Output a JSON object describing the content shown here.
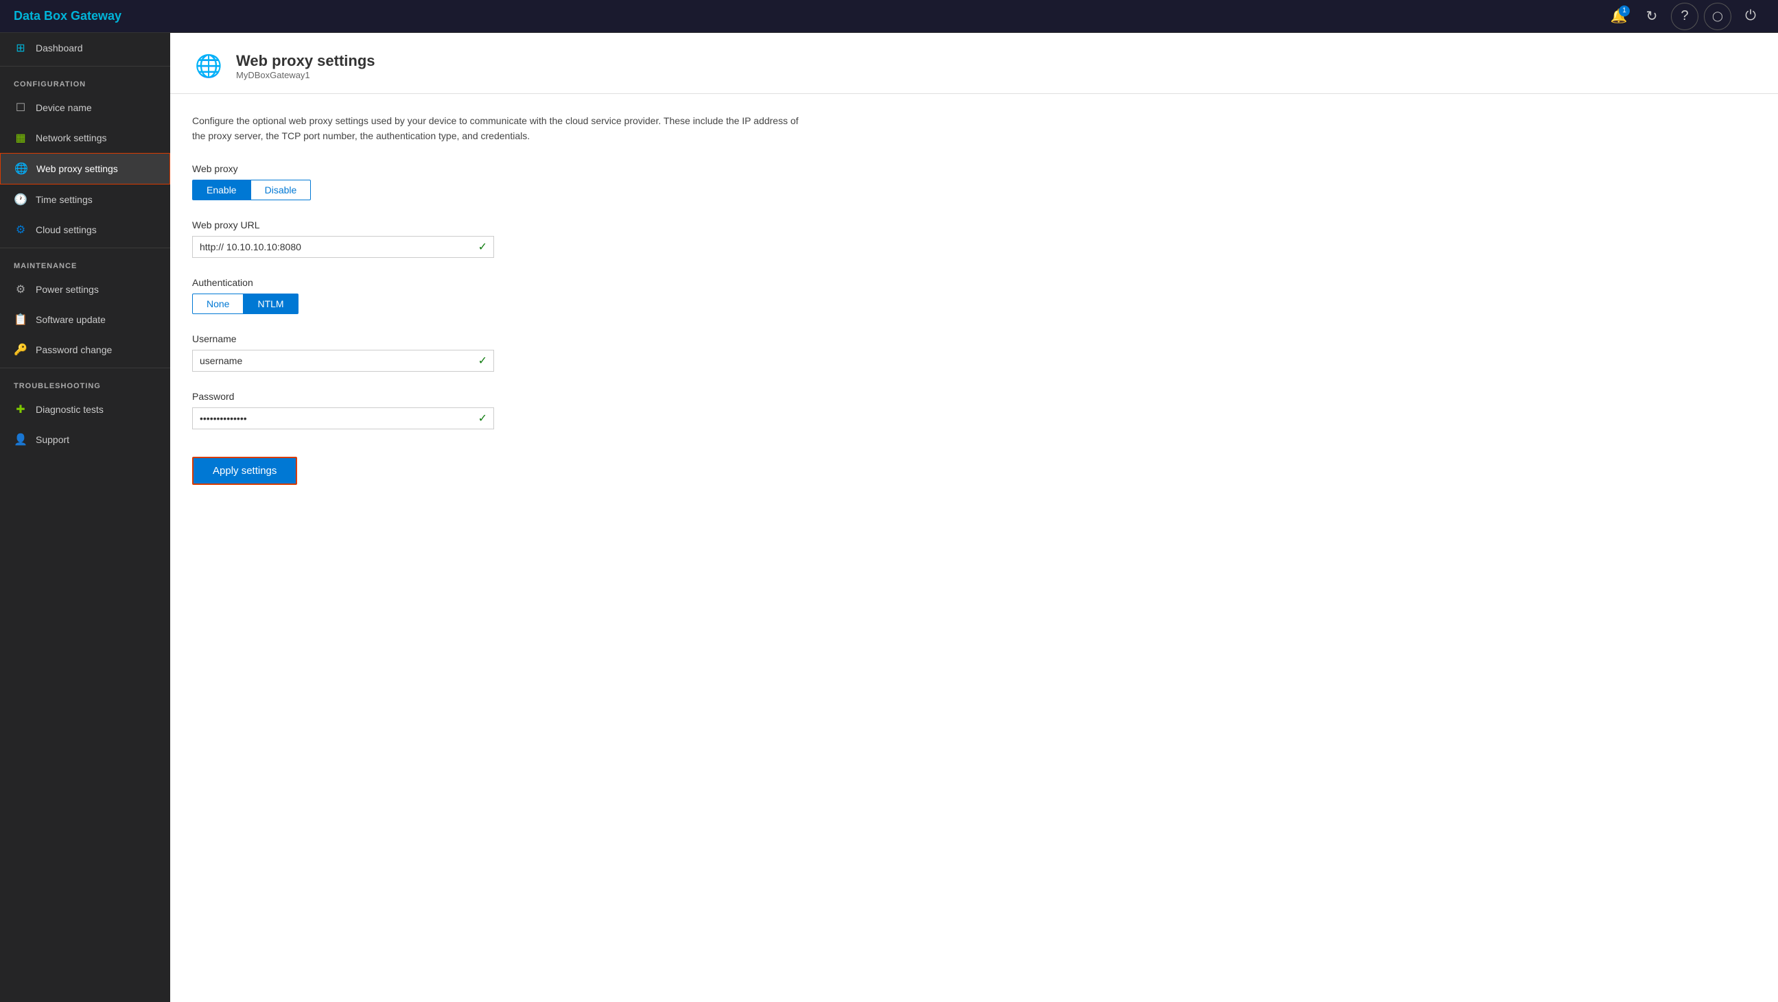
{
  "app": {
    "title": "Data Box Gateway"
  },
  "topbar": {
    "title": "Data Box Gateway",
    "icons": [
      {
        "name": "notification-icon",
        "symbol": "🔔",
        "badge": "1"
      },
      {
        "name": "refresh-icon",
        "symbol": "↻"
      },
      {
        "name": "help-icon",
        "symbol": "?"
      },
      {
        "name": "account-icon",
        "symbol": "○"
      },
      {
        "name": "power-icon",
        "symbol": "⏻"
      }
    ]
  },
  "sidebar": {
    "top_item": {
      "label": "Dashboard",
      "icon": "⊞"
    },
    "sections": [
      {
        "label": "CONFIGURATION",
        "items": [
          {
            "label": "Device name",
            "icon": "□"
          },
          {
            "label": "Network settings",
            "icon": "▦"
          },
          {
            "label": "Web proxy settings",
            "icon": "🌐",
            "active": true
          },
          {
            "label": "Time settings",
            "icon": "🕐"
          },
          {
            "label": "Cloud settings",
            "icon": "⚙"
          }
        ]
      },
      {
        "label": "MAINTENANCE",
        "items": [
          {
            "label": "Power settings",
            "icon": "⚙"
          },
          {
            "label": "Software update",
            "icon": "📋"
          },
          {
            "label": "Password change",
            "icon": "🔑"
          }
        ]
      },
      {
        "label": "TROUBLESHOOTING",
        "items": [
          {
            "label": "Diagnostic tests",
            "icon": "✚"
          },
          {
            "label": "Support",
            "icon": "👤"
          }
        ]
      }
    ]
  },
  "page": {
    "icon": "🌐",
    "title": "Web proxy settings",
    "subtitle": "MyDBoxGateway1",
    "description": "Configure the optional web proxy settings used by your device to communicate with the cloud service provider. These include the IP address of the proxy server, the TCP port  number, the authentication type, and credentials.",
    "web_proxy_label": "Web proxy",
    "enable_label": "Enable",
    "disable_label": "Disable",
    "enable_active": true,
    "url_label": "Web proxy URL",
    "url_value": "http:// 10.10.10.10:8080",
    "auth_label": "Authentication",
    "auth_none_label": "None",
    "auth_ntlm_label": "NTLM",
    "ntlm_active": true,
    "username_label": "Username",
    "username_value": "username",
    "password_label": "Password",
    "password_value": "••••••••••••••",
    "apply_label": "Apply settings"
  }
}
